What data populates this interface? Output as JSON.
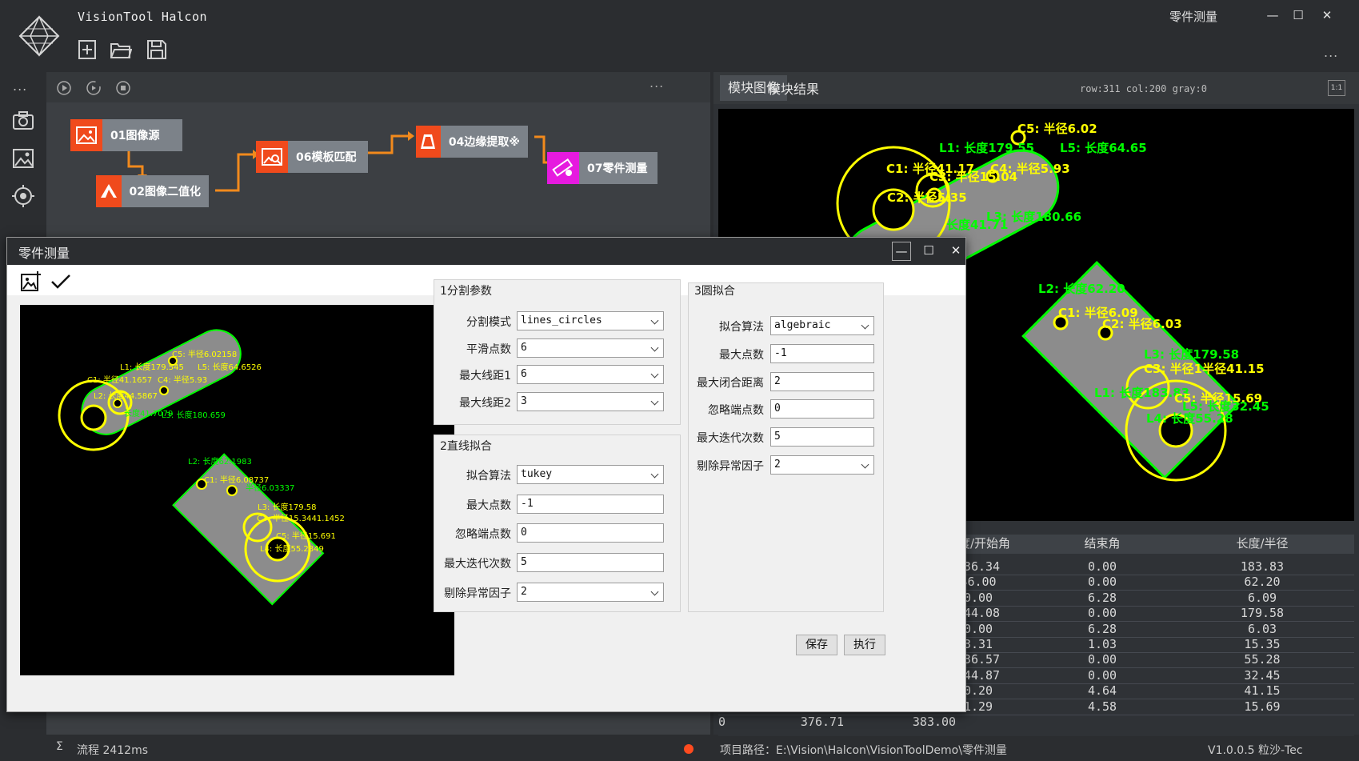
{
  "app": {
    "title": "VisionTool Halcon",
    "window_title": "零件测量",
    "window_controls": [
      "—",
      "☐",
      "✕"
    ],
    "more": "..."
  },
  "toolbar": {
    "new_icon": "new-file-icon",
    "open_icon": "open-folder-icon",
    "save_icon": "save-icon"
  },
  "left_rail": {
    "more": "...",
    "icons": [
      "camera-icon",
      "image-gallery-icon",
      "target-icon"
    ]
  },
  "flow": {
    "toolbar_icons": [
      "play-icon",
      "loop-icon",
      "stop-icon"
    ],
    "more": "...",
    "nodes": [
      {
        "label": "01图像源",
        "icon_color": "#f04a1c",
        "icon": "image-icon"
      },
      {
        "label": "02图像二值化",
        "icon_color": "#f04a1c",
        "icon": "binarize-icon"
      },
      {
        "label": "06模板匹配",
        "icon_color": "#f04a1c",
        "icon": "template-match-icon"
      },
      {
        "label": "04边缘提取※",
        "icon_color": "#f04a1c",
        "icon": "edge-icon"
      },
      {
        "label": "07零件测量",
        "icon_color": "#e61adf",
        "icon": "measure-icon"
      }
    ],
    "connector_color": "#f28a1c"
  },
  "right": {
    "tabs": [
      "模块图像",
      "模块结果"
    ],
    "pixel_info": "row:311 col:200 gray:0",
    "ratio": "1:1"
  },
  "big_image_labels": [
    {
      "text": "C5: 半径6.02",
      "color": "#ffff00"
    },
    {
      "text": "L1: 长度179.55",
      "color": "#00ff00"
    },
    {
      "text": "L5: 长度64.65",
      "color": "#00ff00"
    },
    {
      "text": "C1: 半径41.17",
      "color": "#ffff00"
    },
    {
      "text": "C3: 半径15.04",
      "color": "#ffff00"
    },
    {
      "text": "C4: 半径5.93",
      "color": "#ffff00"
    },
    {
      "text": "C2: 半径5.35",
      "color": "#ffff00"
    },
    {
      "text": "L3: 长度180.66",
      "color": "#00ff00"
    },
    {
      "text": "长度41.71",
      "color": "#00ff00"
    },
    {
      "text": "L2: 长度62.20",
      "color": "#00ff00"
    },
    {
      "text": "C1: 半径6.09",
      "color": "#ffff00"
    },
    {
      "text": "C2: 半径6.03",
      "color": "#ffff00"
    },
    {
      "text": "L3: 长度179.58",
      "color": "#00ff00"
    },
    {
      "text": "C3: 半径1半径41.15",
      "color": "#ffff00"
    },
    {
      "text": "L1: 长度183.83",
      "color": "#00ff00"
    },
    {
      "text": "C5: 半径15.69",
      "color": "#ffff00"
    },
    {
      "text": "L5: 长度32.45",
      "color": "#00ff00"
    },
    {
      "text": "L4: 长度55.28",
      "color": "#00ff00"
    }
  ],
  "results": {
    "headers": [
      "角度/开始角",
      "结束角",
      "长度/半径"
    ],
    "rows": [
      [
        "136.34",
        "0.00",
        "183.83"
      ],
      [
        "46.00",
        "0.00",
        "62.20"
      ],
      [
        "0.00",
        "6.28",
        "6.09"
      ],
      [
        "-44.08",
        "0.00",
        "179.58"
      ],
      [
        "0.00",
        "6.28",
        "6.03"
      ],
      [
        "3.31",
        "1.03",
        "15.35"
      ],
      [
        "136.57",
        "0.00",
        "55.28"
      ],
      [
        "-44.87",
        "0.00",
        "32.45"
      ],
      [
        "0.20",
        "4.64",
        "41.15"
      ],
      [
        "1.29",
        "4.58",
        "15.69"
      ]
    ],
    "partial_row": [
      "10",
      "376.71",
      "383.00"
    ]
  },
  "status": {
    "sigma": "Σ",
    "flow_time": "流程 2412ms",
    "project_path": "项目路径：E:\\Vision\\Halcon\\VisionToolDemo\\零件测量",
    "version": "V1.0.0.5 粒沙-Tec"
  },
  "dialog": {
    "title": "零件测量",
    "toolbar_icons": [
      "load-image-icon",
      "check-icon"
    ],
    "image_labels": [
      {
        "text": "C5: 半径6.02158",
        "color": "#ffff00"
      },
      {
        "text": "L1: 长度179.545",
        "color": "#ffff00"
      },
      {
        "text": "L5: 长度64.6526",
        "color": "#ffff00"
      },
      {
        "text": "C1: 半径41.1657",
        "color": "#ffff00"
      },
      {
        "text": "C4: 半径5.93",
        "color": "#ffff00"
      },
      {
        "text": "L2: 长度44.5867",
        "color": "#ffff00"
      },
      {
        "text": "长度41.7079",
        "color": "#00ff00"
      },
      {
        "text": "L3: 长度180.659",
        "color": "#00ff00"
      },
      {
        "text": "L2: 长度62.1983",
        "color": "#00ff00"
      },
      {
        "text": "C1: 半径6.08737",
        "color": "#ffff00"
      },
      {
        "text": "半径6.03337",
        "color": "#00ff00"
      },
      {
        "text": "L3: 长度179.58",
        "color": "#ffff00"
      },
      {
        "text": "C3: 半径15.3441.1452",
        "color": "#ffff00"
      },
      {
        "text": "C5: 半径15.691",
        "color": "#ffff00"
      },
      {
        "text": "L4: 长度55.2849",
        "color": "#ffff00"
      }
    ],
    "group1": {
      "title": "1分割参数",
      "fields": [
        {
          "label": "分割模式",
          "value": "lines_circles",
          "type": "combo"
        },
        {
          "label": "平滑点数",
          "value": "6",
          "type": "combo"
        },
        {
          "label": "最大线距1",
          "value": "6",
          "type": "combo"
        },
        {
          "label": "最大线距2",
          "value": "3",
          "type": "combo"
        }
      ]
    },
    "group2": {
      "title": "2直线拟合",
      "fields": [
        {
          "label": "拟合算法",
          "value": "tukey",
          "type": "combo"
        },
        {
          "label": "最大点数",
          "value": "-1",
          "type": "text"
        },
        {
          "label": "忽略端点数",
          "value": "0",
          "type": "text"
        },
        {
          "label": "最大迭代次数",
          "value": "5",
          "type": "text"
        },
        {
          "label": "剔除异常因子",
          "value": "2",
          "type": "combo"
        }
      ]
    },
    "group3": {
      "title": "3圆拟合",
      "fields": [
        {
          "label": "拟合算法",
          "value": "algebraic",
          "type": "combo"
        },
        {
          "label": "最大点数",
          "value": "-1",
          "type": "text"
        },
        {
          "label": "最大闭合距离",
          "value": "2",
          "type": "text"
        },
        {
          "label": "忽略端点数",
          "value": "0",
          "type": "text"
        },
        {
          "label": "最大迭代次数",
          "value": "5",
          "type": "text"
        },
        {
          "label": "剔除异常因子",
          "value": "2",
          "type": "combo"
        }
      ]
    },
    "buttons": {
      "save": "保存",
      "run": "执行"
    }
  }
}
